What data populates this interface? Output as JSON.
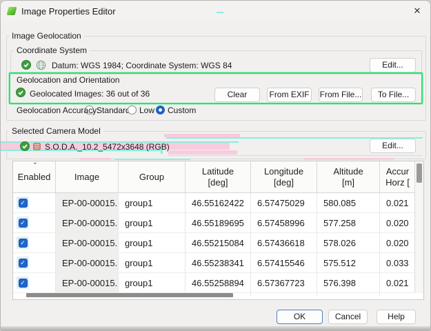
{
  "window": {
    "title": "Image Properties Editor",
    "close_glyph": "✕"
  },
  "geolocation": {
    "group_title": "Image Geolocation",
    "coordinate_system": {
      "title": "Coordinate System",
      "summary": "Datum: WGS 1984; Coordinate System: WGS 84",
      "edit": "Edit..."
    },
    "orientation": {
      "title": "Geolocation and Orientation",
      "status": "Geolocated Images: 36 out of 36",
      "clear": "Clear",
      "from_exif": "From EXIF",
      "from_file": "From File...",
      "to_file": "To File..."
    },
    "accuracy": {
      "label": "Geolocation Accuracy:",
      "options": [
        {
          "label": "Standard",
          "selected": false
        },
        {
          "label": "Low",
          "selected": false
        },
        {
          "label": "Custom",
          "selected": true
        }
      ]
    }
  },
  "camera": {
    "group_title": "Selected Camera Model",
    "model": "S.O.D.A._10.2_5472x3648 (RGB)",
    "edit": "Edit..."
  },
  "table": {
    "sort_indicator": "⌄",
    "columns": [
      {
        "line1": "Enabled",
        "line2": ""
      },
      {
        "line1": "Image",
        "line2": ""
      },
      {
        "line1": "Group",
        "line2": ""
      },
      {
        "line1": "Latitude",
        "line2": "[deg]"
      },
      {
        "line1": "Longitude",
        "line2": "[deg]"
      },
      {
        "line1": "Altitude",
        "line2": "[m]"
      },
      {
        "line1": "Accur",
        "line2": "Horz ["
      }
    ],
    "rows": [
      {
        "enabled": true,
        "image": "EP-00-00015...",
        "group": "group1",
        "latitude": "46.55162422",
        "longitude": "6.57475029",
        "altitude": "580.085",
        "accuracy_horz": "0.021"
      },
      {
        "enabled": true,
        "image": "EP-00-00015...",
        "group": "group1",
        "latitude": "46.55189695",
        "longitude": "6.57458996",
        "altitude": "577.258",
        "accuracy_horz": "0.020"
      },
      {
        "enabled": true,
        "image": "EP-00-00015...",
        "group": "group1",
        "latitude": "46.55215084",
        "longitude": "6.57436618",
        "altitude": "578.026",
        "accuracy_horz": "0.020"
      },
      {
        "enabled": true,
        "image": "EP-00-00015...",
        "group": "group1",
        "latitude": "46.55238341",
        "longitude": "6.57415546",
        "altitude": "575.512",
        "accuracy_horz": "0.033"
      },
      {
        "enabled": true,
        "image": "EP-00-00015...",
        "group": "group1",
        "latitude": "46.55258894",
        "longitude": "6.57367723",
        "altitude": "576.398",
        "accuracy_horz": "0.021"
      }
    ]
  },
  "footer": {
    "ok": "OK",
    "cancel": "Cancel",
    "help": "Help"
  },
  "colors": {
    "highlight_green": "#35dc74",
    "accent_blue": "#1f62c5",
    "check_green": "#3f9e3f",
    "glitch_pink": "#f8cbdf",
    "glitch_cyan": "#8aeede"
  }
}
